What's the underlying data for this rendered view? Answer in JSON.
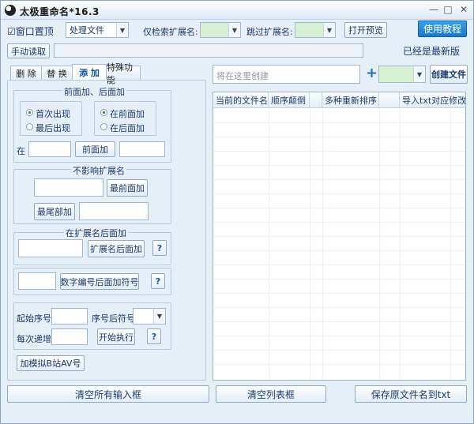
{
  "window": {
    "title": "太极重命名*16.3",
    "minimize_glyph": "—",
    "maximize_glyph": "□",
    "close_glyph": "✕"
  },
  "toolbar": {
    "topmost_label": "窗口置顶",
    "topmost_checked": "☑",
    "mode_value": "处理文件",
    "search_ext_label": "仅检索扩展名:",
    "skip_ext_label": "跳过扩展名:",
    "preview_button": "打开预览",
    "tutorial_button": "使用教程",
    "manual_read_button": "手动读取",
    "version_status": "已经是最新版"
  },
  "tabs": [
    {
      "label": "删 除"
    },
    {
      "label": "替 换"
    },
    {
      "label": "添 加"
    },
    {
      "label": "特殊功能"
    }
  ],
  "add_panel": {
    "front_back_title": "前面加、后面加",
    "first_occurrence": "首次出现",
    "last_occurrence": "最后出现",
    "add_front_radio": "在前面加",
    "add_back_radio": "在后面加",
    "at_label": "在",
    "add_front_button": "前面加",
    "keep_ext_title": "不影响扩展名",
    "add_front_most_button": "最前面加",
    "add_end_button": "最尾部加",
    "after_ext_title": "在扩展名后面加",
    "after_ext_button": "扩展名后面加",
    "help_glyph": "?",
    "after_number_button": "数字编号后面加符号",
    "start_seq_label": "起始序号",
    "seq_suffix_label": "序号后符号",
    "step_label": "每次递增",
    "start_exec_button": "开始执行",
    "bilibili_button": "加模拟B站AV号"
  },
  "right_panel": {
    "create_placeholder": "将在这里创建",
    "plus_glyph": "+",
    "create_file_button": "创建文件",
    "columns": [
      {
        "label": "当前的文件名"
      },
      {
        "label": "顺序颠倒"
      },
      {
        "label": "多种重新排序"
      },
      {
        "label": "导入txt对应修改"
      }
    ]
  },
  "bottom": {
    "clear_inputs_button": "清空所有输入框",
    "clear_list_button": "清空列表框",
    "save_names_button": "保存原文件名到txt"
  },
  "colors": {
    "accent_blue": "#1679cf",
    "ext_field_green": "#d7f0d2"
  }
}
